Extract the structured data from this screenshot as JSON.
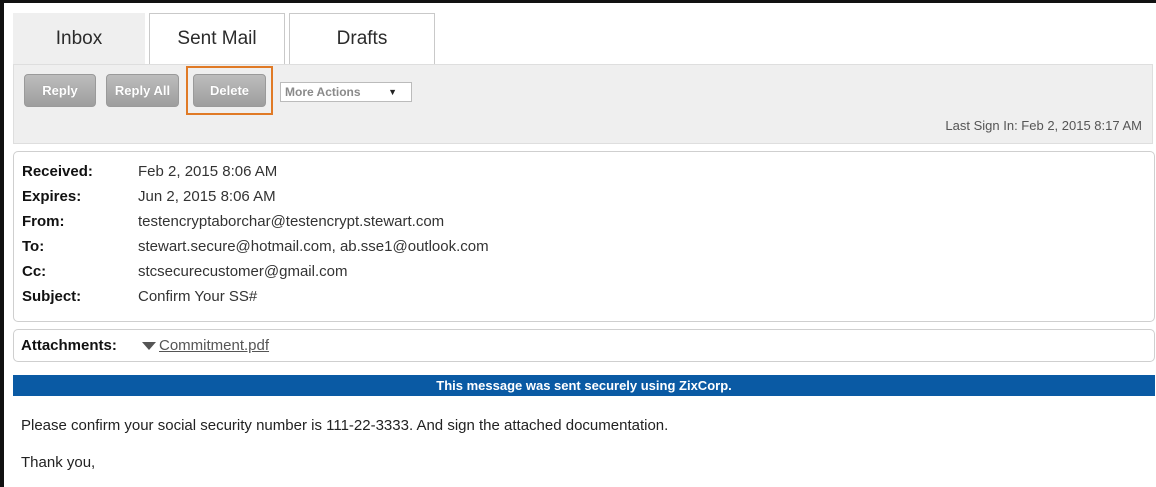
{
  "tabs": [
    {
      "label": "Inbox",
      "active": true
    },
    {
      "label": "Sent Mail",
      "active": false
    },
    {
      "label": "Drafts",
      "active": false
    }
  ],
  "toolbar": {
    "reply_label": "Reply",
    "reply_all_label": "Reply All",
    "delete_label": "Delete",
    "more_actions_label": "More Actions",
    "more_actions_caret": "▼",
    "last_sign_in": "Last Sign In: Feb 2, 2015 8:17 AM"
  },
  "message": {
    "fields": [
      {
        "label": "Received:",
        "value": "Feb 2, 2015 8:06 AM"
      },
      {
        "label": "Expires:",
        "value": "Jun 2, 2015 8:06 AM"
      },
      {
        "label": "From:",
        "value": "testencryptaborchar@testencrypt.stewart.com"
      },
      {
        "label": "To:",
        "value": "stewart.secure@hotmail.com, ab.sse1@outlook.com"
      },
      {
        "label": "Cc:",
        "value": "stcsecurecustomer@gmail.com"
      },
      {
        "label": "Subject:",
        "value": "Confirm Your SS#"
      }
    ],
    "attachments_label": "Attachments:",
    "attachment_file": "Commitment.pdf",
    "secure_banner": "This message was sent securely using ZixCorp.",
    "body_lines": [
      "Please confirm your social security number is 111-22-3333.  And sign the attached documentation.",
      "Thank you,"
    ]
  },
  "colors": {
    "banner": "#0a5aa4",
    "highlight": "#e07a26",
    "button": "#a8a8a8"
  },
  "icons": {
    "attachment_toggle": "caret-down-icon",
    "select_caret": "chevron-down-icon"
  }
}
